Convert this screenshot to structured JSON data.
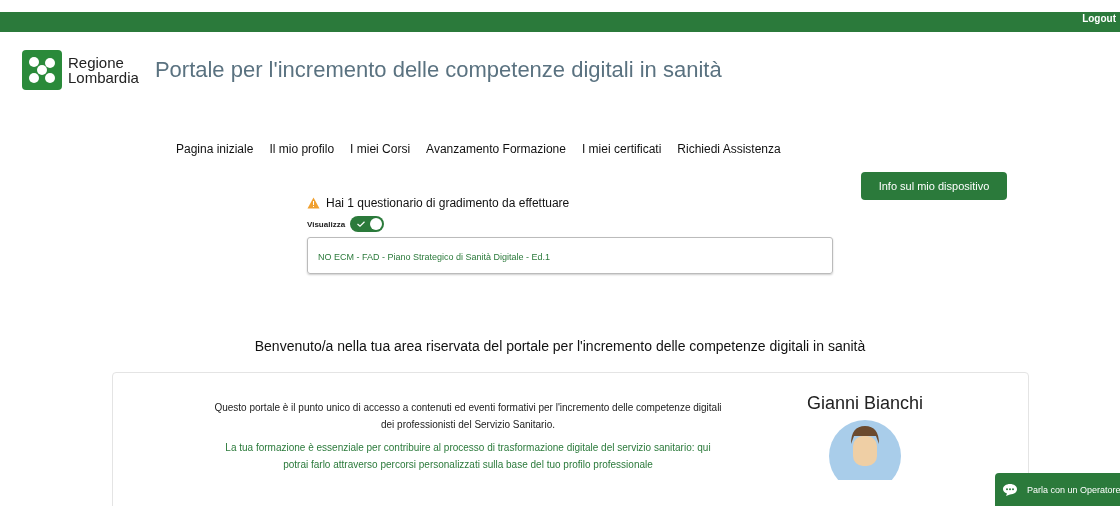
{
  "top_bar": {
    "logout": "Logout"
  },
  "header": {
    "logo_line1": "Regione",
    "logo_line2": "Lombardia",
    "title": "Portale per l'incremento delle competenze digitali in sanità"
  },
  "nav": [
    {
      "label": "Pagina iniziale"
    },
    {
      "label": "Il mio profilo"
    },
    {
      "label": "I miei Corsi"
    },
    {
      "label": "Avanzamento Formazione"
    },
    {
      "label": "I miei certificati"
    },
    {
      "label": "Richiedi Assistenza"
    }
  ],
  "device_button": "Info sul mio dispositivo",
  "survey": {
    "alert": "Hai 1 questionario di gradimento da effettuare",
    "toggle_label": "Visualizza",
    "toggle_on": true,
    "items": [
      "NO ECM - FAD - Piano Strategico di Sanità Digitale - Ed.1"
    ]
  },
  "welcome": "Benvenuto/a nella tua area riservata del portale per l'incremento delle competenze digitali in sanità",
  "card": {
    "intro": "Questo portale è il punto unico di accesso a contenuti ed eventi formativi per l'incremento delle competenze digitali dei professionisti del Servizio Sanitario.",
    "highlight": "La tua formazione è essenziale per contribuire al processo di trasformazione digitale del servizio sanitario: qui potrai farlo attraverso percorsi personalizzati sulla base del tuo profilo professionale",
    "user_name": "Gianni Bianchi"
  },
  "chat_button": "Parla con un Operatore"
}
